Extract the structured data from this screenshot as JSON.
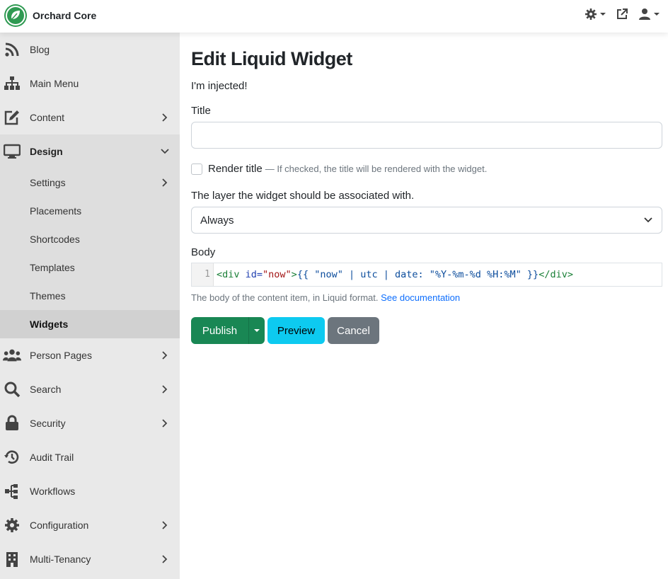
{
  "app": {
    "name": "Orchard Core"
  },
  "topbar": {
    "settings_icon": "gear-icon",
    "external_icon": "external-link-icon",
    "user_icon": "user-icon"
  },
  "sidebar": {
    "items": [
      {
        "label": "Blog",
        "icon": "rss-icon"
      },
      {
        "label": "Main Menu",
        "icon": "sitemap-icon"
      },
      {
        "label": "Content",
        "icon": "edit-icon"
      },
      {
        "label": "Design",
        "icon": "desktop-icon"
      },
      {
        "label": "Person Pages",
        "icon": "users-icon"
      },
      {
        "label": "Search",
        "icon": "search-icon"
      },
      {
        "label": "Security",
        "icon": "lock-icon"
      },
      {
        "label": "Audit Trail",
        "icon": "history-icon"
      },
      {
        "label": "Workflows",
        "icon": "workflow-icon"
      },
      {
        "label": "Configuration",
        "icon": "cog-icon"
      },
      {
        "label": "Multi-Tenancy",
        "icon": "building-icon"
      }
    ],
    "design_sub": [
      {
        "label": "Settings"
      },
      {
        "label": "Placements"
      },
      {
        "label": "Shortcodes"
      },
      {
        "label": "Templates"
      },
      {
        "label": "Themes"
      },
      {
        "label": "Widgets"
      }
    ]
  },
  "main": {
    "title": "Edit Liquid Widget",
    "injected": "I'm injected!",
    "title_label": "Title",
    "title_value": "",
    "render_title_label": "Render title",
    "render_title_hint": "— If checked, the title will be rendered with the widget.",
    "layer_label": "The layer the widget should be associated with.",
    "layer_value": "Always",
    "body_label": "Body",
    "editor": {
      "line_number": "1",
      "code_open_tag": "<div",
      "code_attr": " id=",
      "code_attr_value": "\"now\"",
      "code_close_bracket": ">",
      "code_liquid": "{{ \"now\" | utc | date: \"%Y-%m-%d %H:%M\" }}",
      "code_end_tag": "</div>"
    },
    "help_text": "The body of the content item, in Liquid format.",
    "help_link": "See documentation",
    "buttons": {
      "publish": "Publish",
      "preview": "Preview",
      "cancel": "Cancel"
    }
  },
  "colors": {
    "brand": "#2f9a52",
    "publish": "#198754",
    "preview": "#0dcaf0",
    "cancel": "#6c757d",
    "link": "#0d6efd"
  }
}
